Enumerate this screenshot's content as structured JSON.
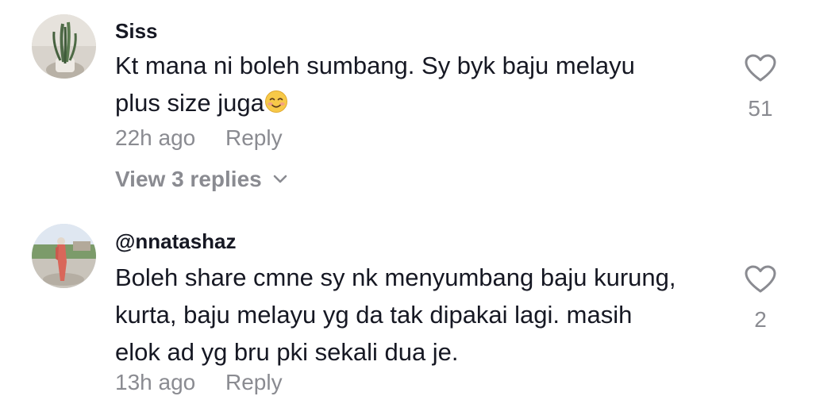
{
  "comments": [
    {
      "username": "Siss",
      "text_line1": "Kt mana ni boleh sumbang. Sy byk baju melayu",
      "text_line2": "plus size juga",
      "emoji_icon": "smiling-face-icon",
      "time": "22h ago",
      "reply_label": "Reply",
      "view_replies": "View 3 replies",
      "likes": "51"
    },
    {
      "username": "@nnatashaz",
      "text_line1": "Boleh share cmne sy nk menyumbang baju kurung,",
      "text_line2": "kurta, baju melayu yg da tak dipakai lagi. masih",
      "text_line3": "elok ad yg bru pki sekali dua je.",
      "time": "13h ago",
      "reply_label": "Reply",
      "likes": "2"
    }
  ],
  "colors": {
    "primary_text": "#161823",
    "secondary_text": "#8a8b91"
  }
}
